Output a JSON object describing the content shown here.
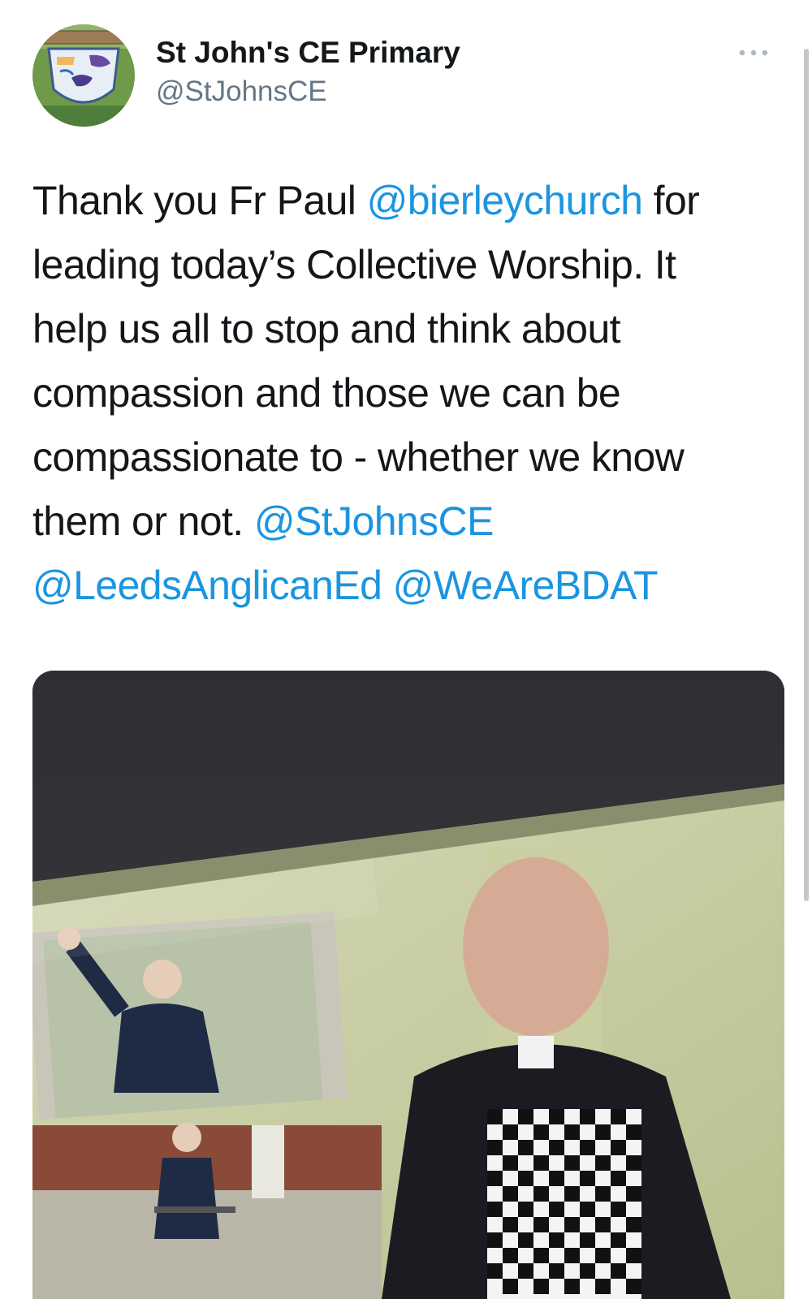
{
  "tweet": {
    "display_name": "St John's CE Primary",
    "handle": "@StJohnsCE",
    "more_icon": "more-horizontal-icon",
    "text_lines": [
      [
        {
          "t": "Thank you Fr Paul "
        },
        {
          "t": "@bierleychurch",
          "mention": true
        },
        {
          "t": " for"
        }
      ],
      [
        {
          "t": "leading today’s Collective Worship. It"
        }
      ],
      [
        {
          "t": "help us all to stop and think about"
        }
      ],
      [
        {
          "t": "compassion and those we can be"
        }
      ],
      [
        {
          "t": "compassionate to - whether we know"
        }
      ],
      [
        {
          "t": "them or not. "
        },
        {
          "t": "@StJohnsCE",
          "mention": true
        }
      ],
      [
        {
          "t": "@LeedsAnglicanEd",
          "mention": true
        },
        {
          "t": " "
        },
        {
          "t": "@WeAreBDAT",
          "mention": true
        }
      ]
    ],
    "media_alt": "Photo of a screen showing a priest in a chequered apron beside photos of Captain Tom Moore"
  },
  "colors": {
    "mention": "#1b95e0",
    "name": "#14171a",
    "handle": "#657786"
  }
}
